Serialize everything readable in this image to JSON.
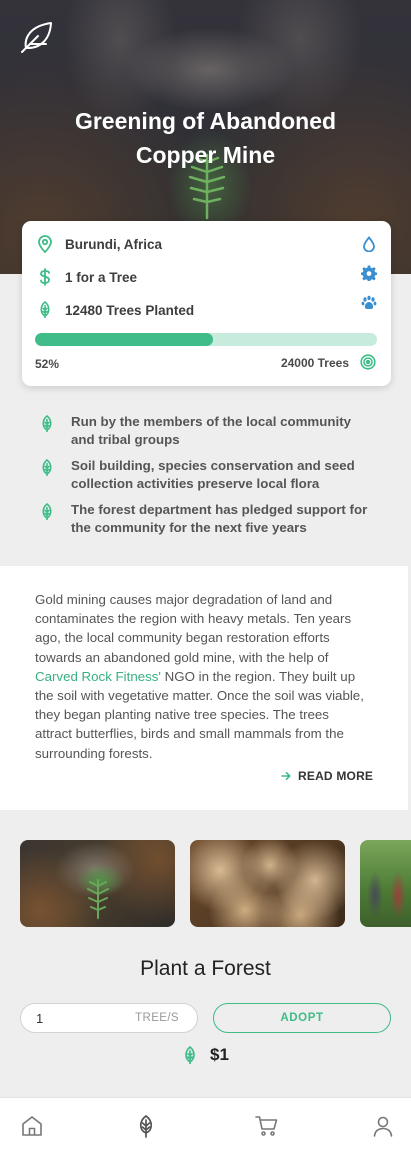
{
  "hero": {
    "title": "Greening of Abandoned Copper Mine",
    "logo_icon": "feather-icon"
  },
  "info": {
    "location": "Burundi, Africa",
    "price_label": "1 for a Tree",
    "planted": "12480 Trees Planted",
    "progress_percent": 52,
    "progress_label": "52%",
    "goal": "24000 Trees",
    "side_icons": [
      "water-drop-icon",
      "gear-icon",
      "paw-icon"
    ],
    "accent_color": "#3fbc88"
  },
  "bullets": [
    "Run by the members of the local community and tribal groups",
    "Soil building, species conservation and seed collection activities preserve local flora",
    "The forest department has pledged support for the community for the next five years"
  ],
  "description": {
    "part1": "Gold mining causes major degradation of land and contaminates the region with heavy metals. Ten years ago, the local community began restoration efforts towards an abandoned gold mine, with the help of ",
    "link": "Carved Rock Fitness'",
    "part2": " NGO in the region. They built up the soil with vegetative matter. Once the soil was viable, they began planting native tree species. The trees attract butterflies, birds and small mammals from the surrounding forests.",
    "read_more": "READ MORE"
  },
  "gallery": [
    "fern-in-hands-photo",
    "seedlings-photo",
    "community-photo"
  ],
  "plant": {
    "title": "Plant a Forest",
    "quantity": "1",
    "unit": "TREE/S",
    "adopt_label": "ADOPT",
    "price": "$1"
  },
  "nav": [
    "home-icon",
    "tree-icon",
    "cart-icon",
    "user-icon"
  ]
}
